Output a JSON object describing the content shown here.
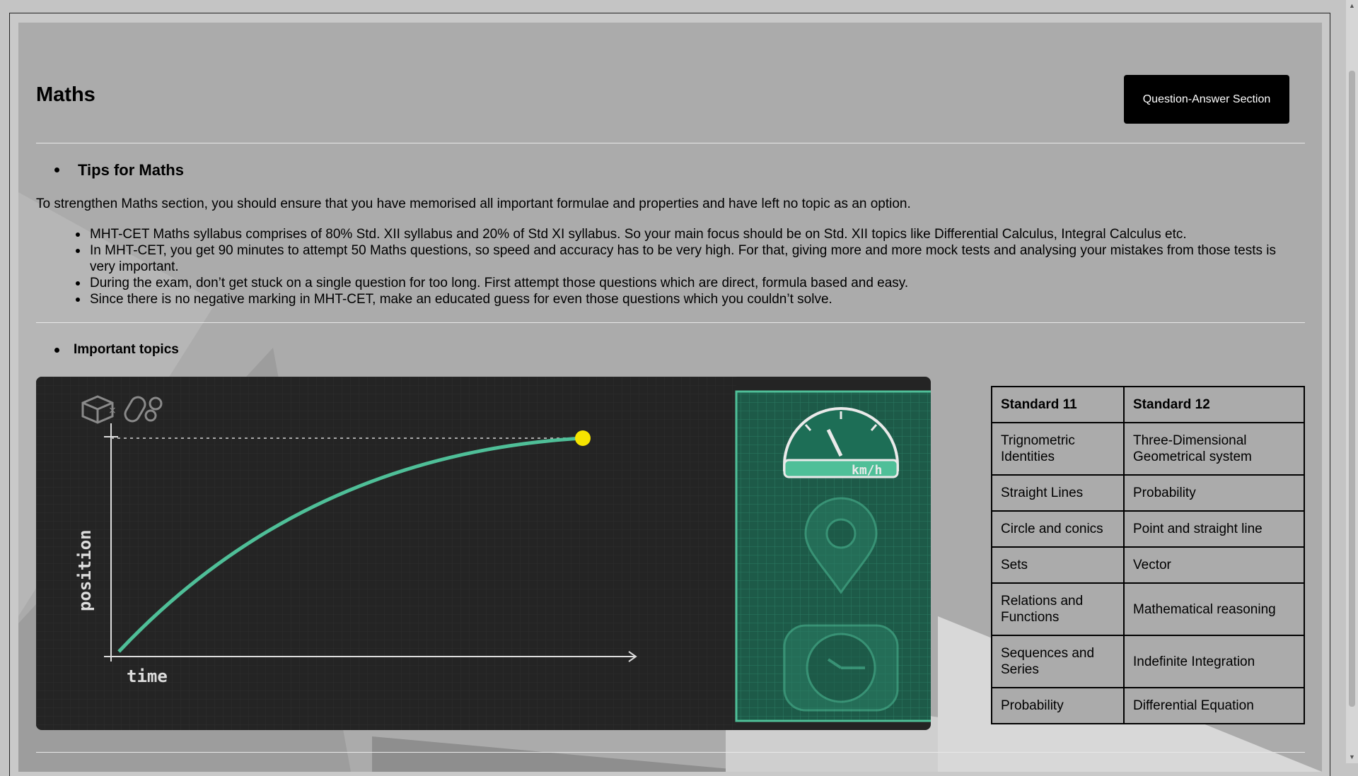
{
  "page_title": "Maths",
  "qa_button_label": "Question-Answer Section",
  "tips": {
    "heading": "Tips for Maths",
    "intro": "To strengthen Maths section, you should ensure that you have memorised all important formulae and properties and have left no topic as an option.",
    "items": [
      "MHT-CET Maths syllabus comprises of 80% Std. XII syllabus and 20% of Std XI syllabus. So your main focus should be on Std. XII topics like Differential Calculus, Integral Calculus etc.",
      "In MHT-CET, you get 90 minutes to attempt 50 Maths questions, so speed and accuracy has to be very high. For that, giving more and more mock tests and analysing your mistakes from those tests is very important.",
      "During the exam, don’t get stuck on a single question for too long. First attempt those questions which are direct, formula based and easy.",
      "Since there is no negative marking in MHT-CET, make an educated guess for even those questions which you couldn’t solve."
    ]
  },
  "topics": {
    "heading": "Important topics",
    "illustration": {
      "y_axis_label": "position",
      "x_axis_label": "time",
      "speedometer_unit": "km/h",
      "icons": [
        "cube-icon",
        "particles-icon",
        "speedometer-icon",
        "location-pin-icon",
        "clock-icon"
      ],
      "colors": {
        "curve": "#4fbf98",
        "point": "#f5e400",
        "panel": "#1d5a48",
        "background": "#242424"
      }
    },
    "table": {
      "headers": [
        "Standard 11",
        "Standard 12"
      ],
      "rows": [
        [
          "Trignometric Identities",
          "Three-Dimensional Geometrical system"
        ],
        [
          "Straight Lines",
          "Probability"
        ],
        [
          "Circle and conics",
          "Point and straight line"
        ],
        [
          "Sets",
          "Vector"
        ],
        [
          "Relations and Functions",
          "Mathematical reasoning"
        ],
        [
          "Sequences and Series",
          "Indefinite Integration"
        ],
        [
          "Probability",
          "Differential Equation"
        ]
      ]
    }
  }
}
